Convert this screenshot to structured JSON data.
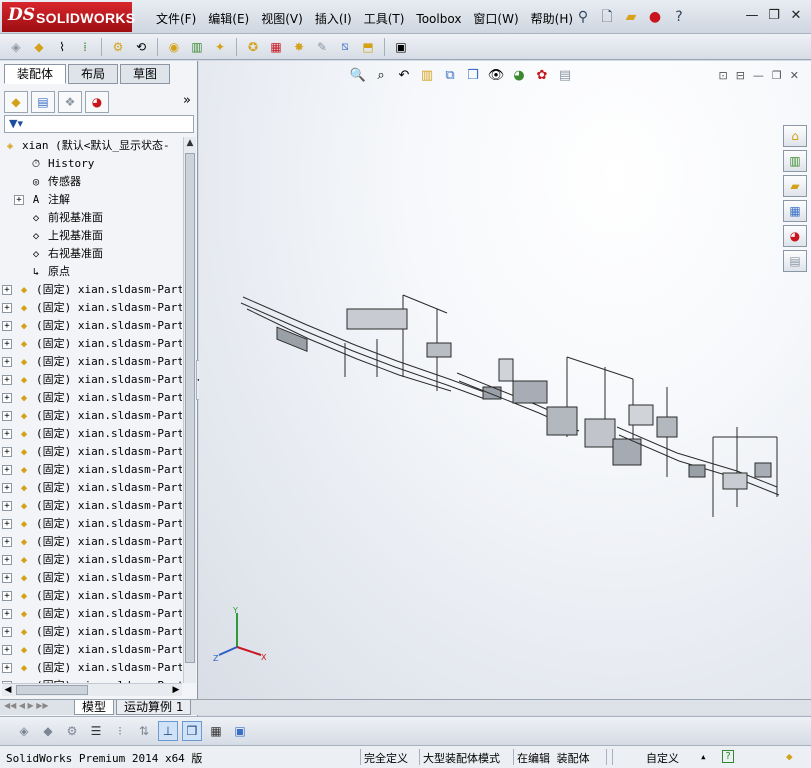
{
  "app": {
    "brand_ds": "DS",
    "brand_name": "SOLIDWORKS"
  },
  "menu": [
    "文件(F)",
    "编辑(E)",
    "视图(V)",
    "插入(I)",
    "工具(T)",
    "Toolbox",
    "窗口(W)",
    "帮助(H)"
  ],
  "panel_tabs": [
    "装配体",
    "布局",
    "草图"
  ],
  "tree": {
    "root_label": "xian  (默认<默认_显示状态-",
    "nodes": [
      {
        "label": "History",
        "icon": "history-icon"
      },
      {
        "label": "传感器",
        "icon": "sensor-icon"
      },
      {
        "label": "注解",
        "icon": "annotation-icon",
        "expandable": true
      },
      {
        "label": "前视基准面",
        "icon": "plane-icon"
      },
      {
        "label": "上视基准面",
        "icon": "plane-icon"
      },
      {
        "label": "右视基准面",
        "icon": "plane-icon"
      },
      {
        "label": "原点",
        "icon": "origin-icon"
      }
    ],
    "part_label": "(固定) xian.sldasm-Part",
    "part_count": 23
  },
  "bottom_tabs": [
    "模型",
    "运动算例 1"
  ],
  "status": {
    "app_version": "SolidWorks Premium 2014 x64 版",
    "fully_defined": "完全定义",
    "large_assembly": "大型装配体模式",
    "editing": "在编辑 装配体",
    "custom": "自定义",
    "help_glyph": "?"
  },
  "colors": {
    "brand_red": "#c8161c",
    "titlebar": "#dde3eb",
    "status_bar": "#eceff3"
  }
}
